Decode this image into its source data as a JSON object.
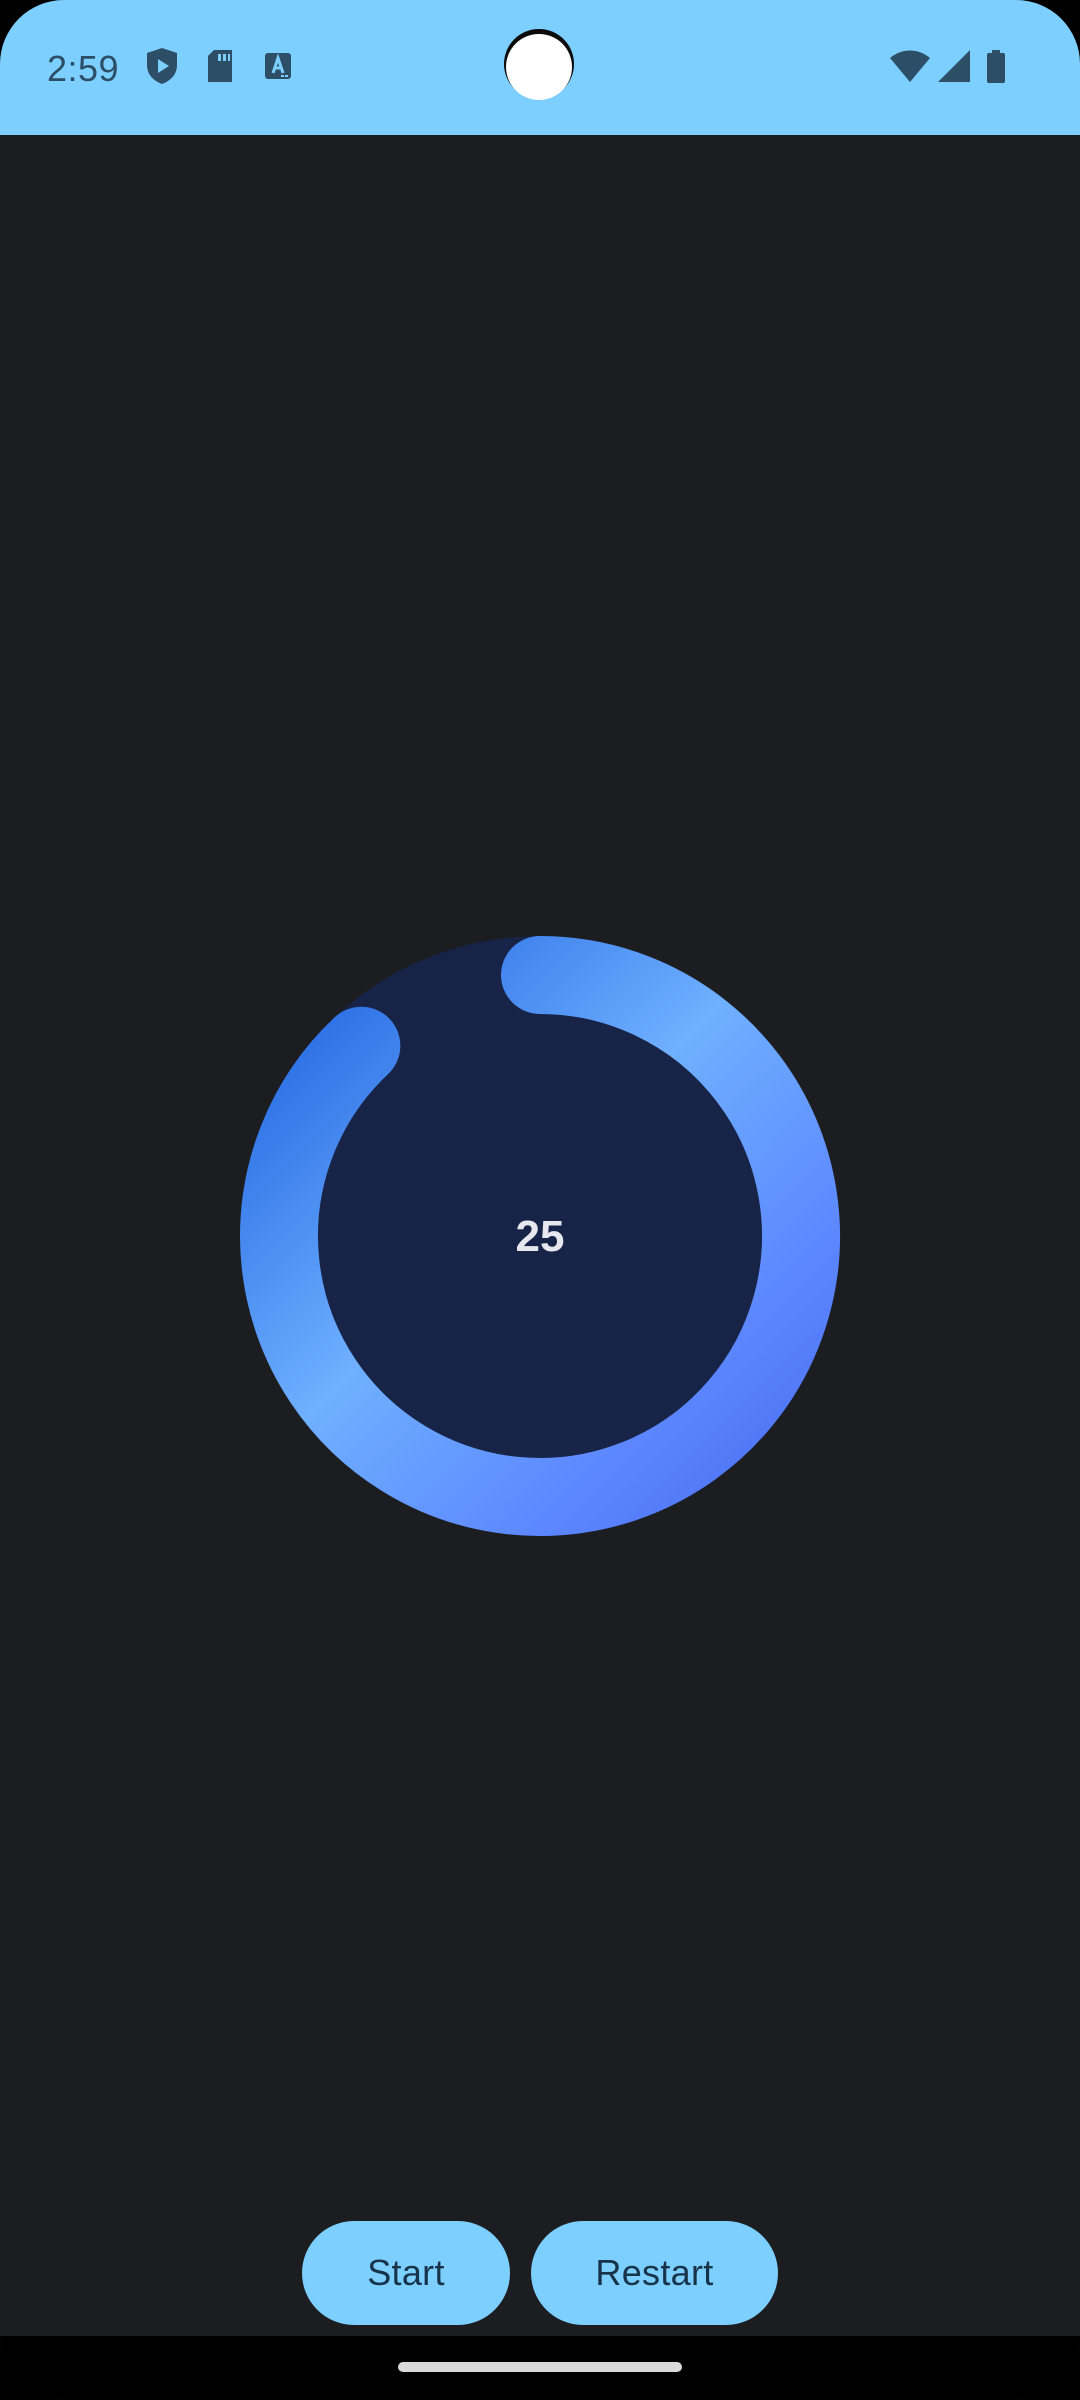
{
  "status_bar": {
    "time": "2:59",
    "background_color": "#7ccfff",
    "left_icons": [
      "shield-play-icon",
      "sd-card-icon",
      "text-a-icon"
    ],
    "right_icons": [
      "wifi-icon",
      "cell-signal-icon",
      "battery-icon"
    ]
  },
  "timer": {
    "value": "25",
    "progress_fraction": 0.88,
    "track_color": "#172447",
    "gradient_colors": [
      "#2a72e6",
      "#73b2ff",
      "#5f86ff",
      "#4a73f5"
    ]
  },
  "controls": {
    "start_label": "Start",
    "restart_label": "Restart",
    "button_color": "#7ccfff"
  },
  "colors": {
    "background": "#1b1d20",
    "text_dark": "#163349"
  }
}
